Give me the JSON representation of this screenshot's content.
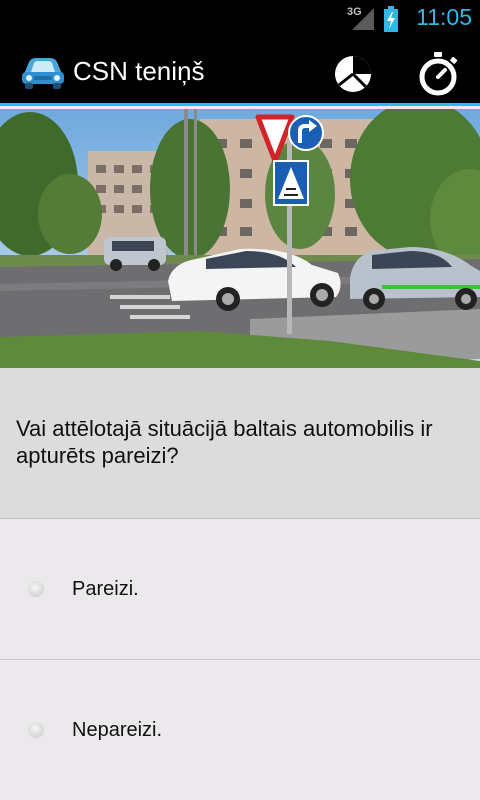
{
  "status_bar": {
    "network": "3G",
    "time": "11:05",
    "signal_icon": "signal-icon",
    "battery_icon": "battery-charging-icon",
    "accent_color": "#33b5e5"
  },
  "action_bar": {
    "title": "CSN teniņš",
    "app_icon": "car-icon",
    "actions": [
      {
        "icon": "pie-chart-icon"
      },
      {
        "icon": "stopwatch-icon"
      }
    ]
  },
  "question": {
    "text": "Vai attēlotajā situācijā baltais automobilis ir apturēts pareizi?"
  },
  "answers": [
    {
      "label": "Pareizi.",
      "selected": false
    },
    {
      "label": "Nepareizi.",
      "selected": false
    }
  ]
}
